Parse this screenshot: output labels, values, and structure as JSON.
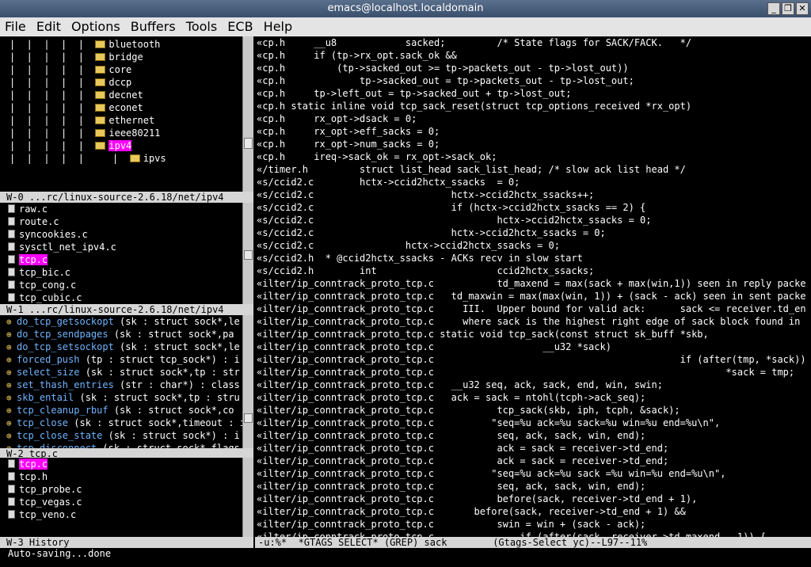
{
  "window": {
    "title": "emacs@localhost.localdomain",
    "btn_min": "_",
    "btn_max": "❐",
    "btn_close": "✕"
  },
  "menu": [
    "File",
    "Edit",
    "Options",
    "Buffers",
    "Tools",
    "ECB",
    "Help"
  ],
  "dirs": {
    "items": [
      {
        "label": "bluetooth"
      },
      {
        "label": "bridge"
      },
      {
        "label": "core"
      },
      {
        "label": "dccp"
      },
      {
        "label": "decnet"
      },
      {
        "label": "econet"
      },
      {
        "label": "ethernet"
      },
      {
        "label": "ieee80211"
      },
      {
        "label": "ipv4",
        "selected": true
      },
      {
        "label": "ipvs"
      }
    ],
    "modeline": "W-0 ...rc/linux-source-2.6.18/net/ipv4"
  },
  "sources": {
    "items": [
      {
        "label": "raw.c"
      },
      {
        "label": "route.c"
      },
      {
        "label": "syncookies.c"
      },
      {
        "label": "sysctl_net_ipv4.c"
      },
      {
        "label": "tcp.c",
        "selected": true
      },
      {
        "label": "tcp_bic.c"
      },
      {
        "label": "tcp_cong.c"
      },
      {
        "label": "tcp_cubic.c"
      }
    ],
    "modeline": "W-1 ...rc/linux-source-2.6.18/net/ipv4"
  },
  "methods": {
    "items": [
      {
        "name": "do_tcp_getsockopt",
        "args": " (sk : struct sock*,le"
      },
      {
        "name": "do_tcp_sendpages",
        "args": " (sk : struct sock*,pa"
      },
      {
        "name": "do_tcp_setsockopt",
        "args": " (sk : struct sock*,le"
      },
      {
        "name": "forced_push",
        "args": " (tp : struct tcp_sock*) : i"
      },
      {
        "name": "select_size",
        "args": " (sk : struct sock*,tp : str"
      },
      {
        "name": "set_thash_entries",
        "args": " (str : char*) : class"
      },
      {
        "name": "skb_entail",
        "args": " (sk : struct sock*,tp : stru"
      },
      {
        "name": "tcp_cleanup_rbuf",
        "args": " (sk : struct sock*,co"
      },
      {
        "name": "tcp_close",
        "args": " (sk : struct sock*,timeout : i"
      },
      {
        "name": "tcp_close_state",
        "args": " (sk : struct sock*) : i"
      },
      {
        "name": "tcp_disconnect",
        "args": " (sk : struct sock*,flags"
      }
    ],
    "modeline": "W-2 tcp.c"
  },
  "history": {
    "items": [
      {
        "label": "tcp.c",
        "selected": true
      },
      {
        "label": "tcp.h"
      },
      {
        "label": "tcp_probe.c"
      },
      {
        "label": "tcp_vegas.c"
      },
      {
        "label": "tcp_veno.c"
      }
    ],
    "modeline": "W-3 History"
  },
  "grep": {
    "lines": [
      "cp.h     __u8            sacked;         /* State flags for SACK/FACK.   */",
      "cp.h     if (tp->rx_opt.sack_ok &&",
      "cp.h         (tp->sacked_out >= tp->packets_out - tp->lost_out))",
      "cp.h             tp->sacked_out = tp->packets_out - tp->lost_out;",
      "cp.h     tp->left_out = tp->sacked_out + tp->lost_out;",
      "cp.h static inline void tcp_sack_reset(struct tcp_options_received *rx_opt)",
      "cp.h     rx_opt->dsack = 0;",
      "cp.h     rx_opt->eff_sacks = 0;",
      "cp.h     rx_opt->num_sacks = 0;",
      "cp.h     ireq->sack_ok = rx_opt->sack_ok;",
      "/timer.h         struct list_head sack_list_head; /* slow ack list head */",
      "s/ccid2.c        hctx->ccid2hctx_ssacks  = 0;",
      "s/ccid2.c                        hctx->ccid2hctx_ssacks++;",
      "s/ccid2.c                        if (hctx->ccid2hctx_ssacks == 2) {",
      "s/ccid2.c                                hctx->ccid2hctx_ssacks = 0;",
      "s/ccid2.c                        hctx->ccid2hctx_ssacks = 0;",
      "s/ccid2.c                hctx->ccid2hctx_ssacks = 0;",
      "s/ccid2.h  * @ccid2hctx_ssacks - ACKs recv in slow start",
      "s/ccid2.h        int                     ccid2hctx_ssacks;",
      "ilter/ip_conntrack_proto_tcp.c           td_maxend = max(sack + max(win,1)) seen in reply packe",
      "ilter/ip_conntrack_proto_tcp.c   td_maxwin = max(max(win, 1)) + (sack - ack) seen in sent packe",
      "ilter/ip_conntrack_proto_tcp.c     III.  Upper bound for valid ack:      sack <= receiver.td_en",
      "ilter/ip_conntrack_proto_tcp.c     where sack is the highest right edge of sack block found in",
      "ilter/ip_conntrack_proto_tcp.c static void tcp_sack(const struct sk_buff *skb,",
      "ilter/ip_conntrack_proto_tcp.c                   __u32 *sack)",
      "ilter/ip_conntrack_proto_tcp.c                                           if (after(tmp, *sack))",
      "ilter/ip_conntrack_proto_tcp.c                                                   *sack = tmp;",
      "ilter/ip_conntrack_proto_tcp.c   __u32 seq, ack, sack, end, win, swin;",
      "ilter/ip_conntrack_proto_tcp.c   ack = sack = ntohl(tcph->ack_seq);",
      "ilter/ip_conntrack_proto_tcp.c           tcp_sack(skb, iph, tcph, &sack);",
      "ilter/ip_conntrack_proto_tcp.c          \"seq=%u ack=%u sack=%u win=%u end=%u\\n\",",
      "ilter/ip_conntrack_proto_tcp.c           seq, ack, sack, win, end);",
      "ilter/ip_conntrack_proto_tcp.c           ack = sack = receiver->td_end;",
      "ilter/ip_conntrack_proto_tcp.c           ack = sack = receiver->td_end;",
      "ilter/ip_conntrack_proto_tcp.c          \"seq=%u ack=%u sack =%u win=%u end=%u\\n\",",
      "ilter/ip_conntrack_proto_tcp.c           seq, ack, sack, win, end);",
      "ilter/ip_conntrack_proto_tcp.c           before(sack, receiver->td_end + 1),",
      "ilter/ip_conntrack_proto_tcp.c       before(sack, receiver->td_end + 1) &&",
      "ilter/ip_conntrack_proto_tcp.c           swin = win + (sack - ack);",
      "ilter/ip_conntrack_proto_tcp.c               if (after(sack, receiver->td_maxend - 1)) {"
    ],
    "modeline": "-u:%*  *GTAGS SELECT* (GREP) sack        (Gtags-Select yc)--L97--11%"
  },
  "minibuffer": "Auto-saving...done"
}
